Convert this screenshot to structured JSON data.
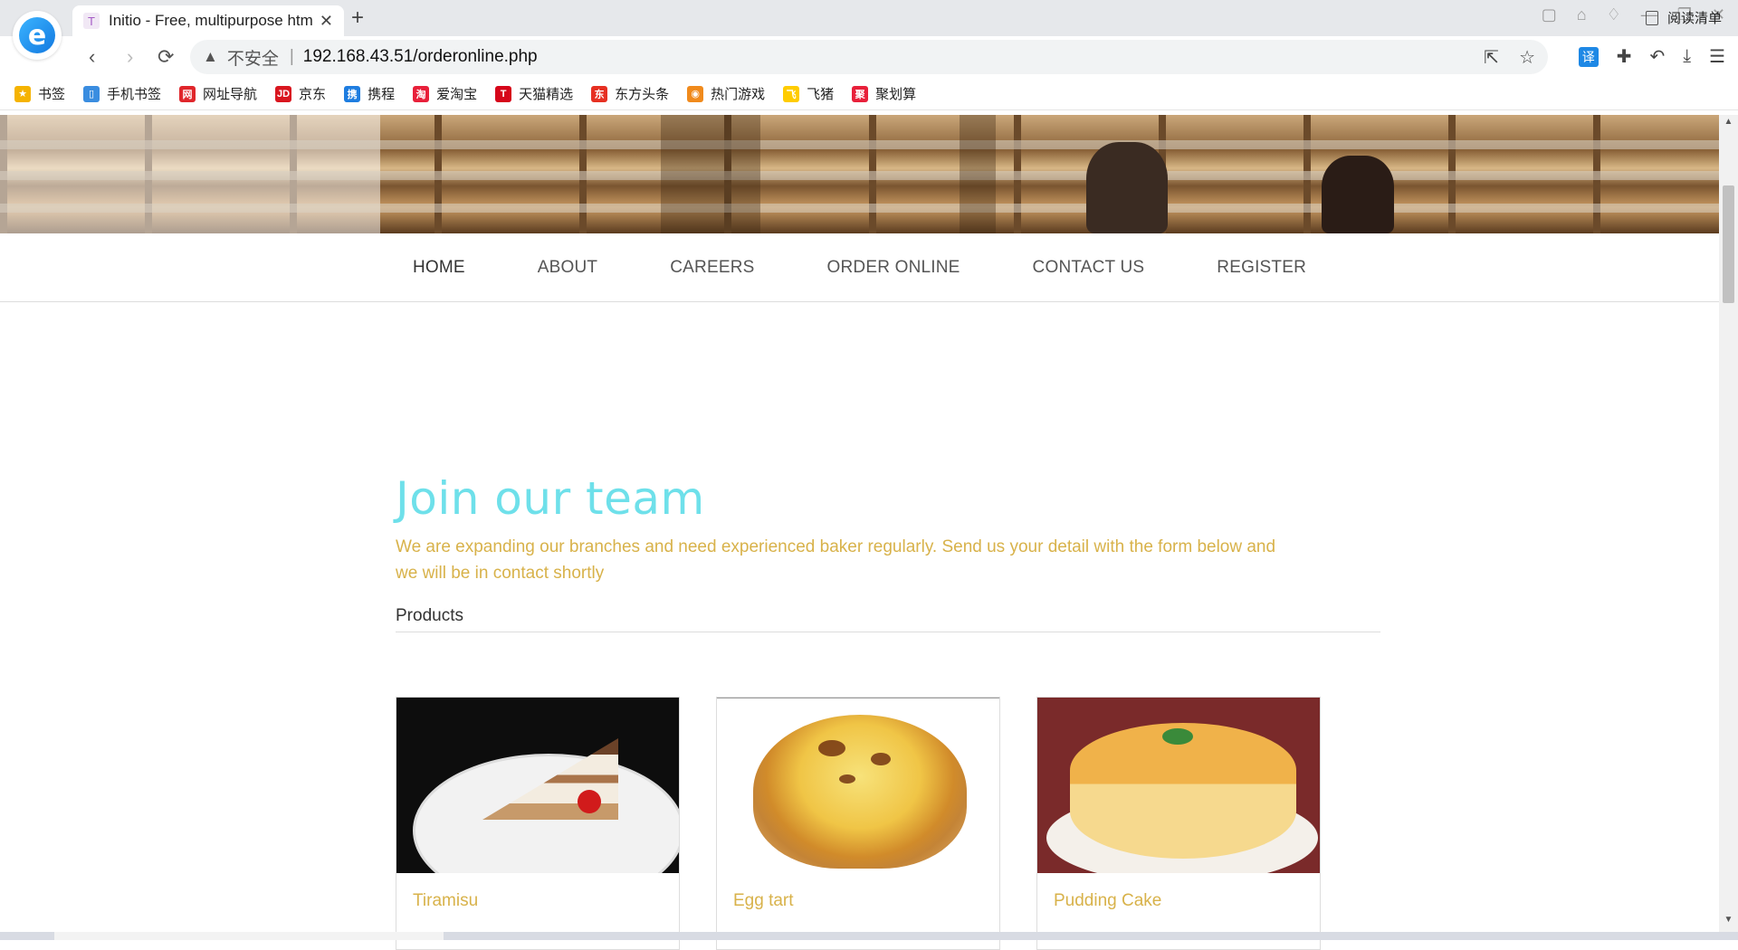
{
  "browser": {
    "tab_title": "Initio - Free, multipurpose htm",
    "tab_favicon": "T",
    "new_tab": "+",
    "close_tab": "✕",
    "insecure_label": "不安全",
    "url": "192.168.43.51/orderonline.php",
    "back": "‹",
    "forward": "›",
    "reload": "⟳",
    "translate": "译"
  },
  "bookmarks": [
    {
      "label": "书签",
      "icon": "star-icon",
      "color": "#f5b301",
      "glyph": "★"
    },
    {
      "label": "手机书签",
      "icon": "phone-icon",
      "color": "#3a8de0",
      "glyph": "▯"
    },
    {
      "label": "网址导航",
      "icon": "nav-icon",
      "color": "#e0262b",
      "glyph": "网"
    },
    {
      "label": "京东",
      "icon": "jd-icon",
      "color": "#d9161f",
      "glyph": "JD"
    },
    {
      "label": "携程",
      "icon": "ctrip-icon",
      "color": "#1e7de0",
      "glyph": "携"
    },
    {
      "label": "爱淘宝",
      "icon": "taobao-icon",
      "color": "#e8203a",
      "glyph": "淘"
    },
    {
      "label": "天猫精选",
      "icon": "tmall-icon",
      "color": "#d6061a",
      "glyph": "T"
    },
    {
      "label": "东方头条",
      "icon": "toutiao-icon",
      "color": "#e63022",
      "glyph": "东"
    },
    {
      "label": "热门游戏",
      "icon": "game-icon",
      "color": "#f08a1c",
      "glyph": "◉"
    },
    {
      "label": "飞猪",
      "icon": "fliggy-icon",
      "color": "#ffcc00",
      "glyph": "飞"
    },
    {
      "label": "聚划算",
      "icon": "juhuasuan-icon",
      "color": "#e8203a",
      "glyph": "聚"
    }
  ],
  "reading_list": "阅读清单",
  "nav": [
    "HOME",
    "ABOUT",
    "CAREERS",
    "ORDER ONLINE",
    "CONTACT US",
    "REGISTER"
  ],
  "main": {
    "heading": "Join our team",
    "lead": "We are expanding our branches and need experienced baker regularly. Send us your detail with the form below and we will be in contact shortly",
    "section_title": "Products"
  },
  "products": [
    {
      "name": "Tiramisu"
    },
    {
      "name": "Egg tart"
    },
    {
      "name": "Pudding Cake"
    }
  ],
  "colors": {
    "heading": "#6ee0ea",
    "accent_gold": "#d8b24a"
  }
}
